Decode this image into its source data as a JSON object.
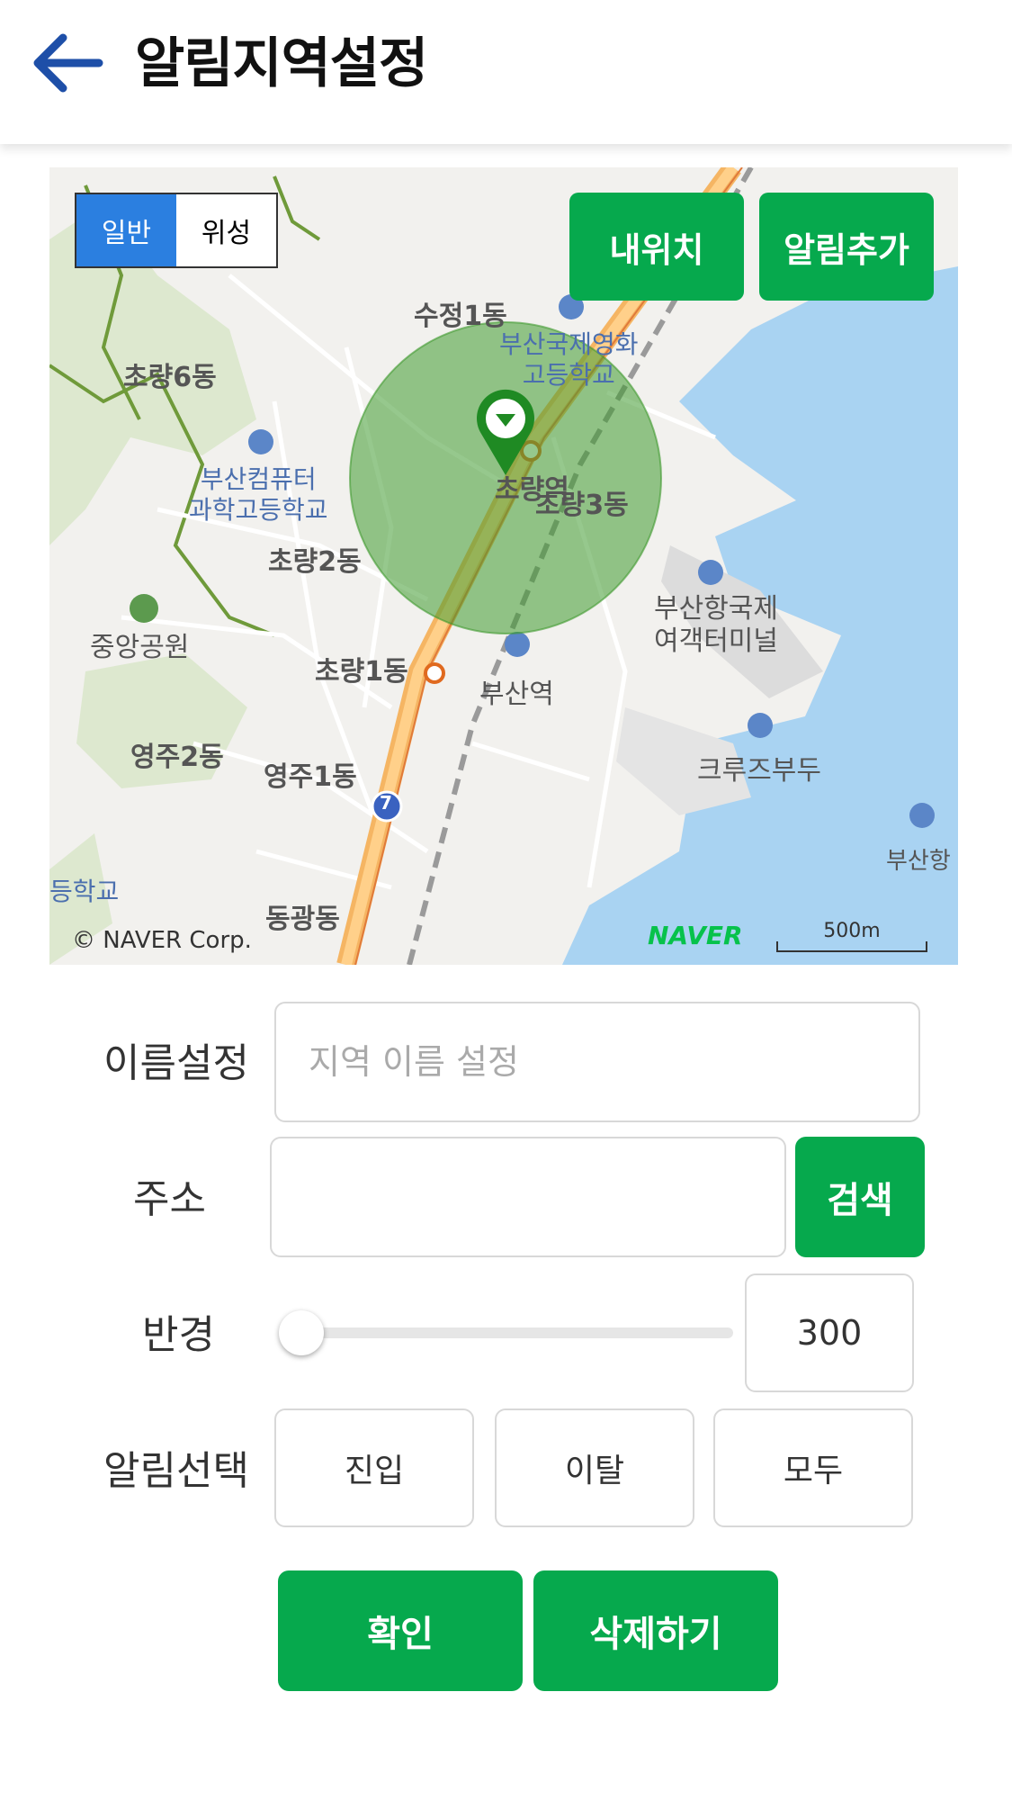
{
  "header": {
    "title": "알림지역설정"
  },
  "map": {
    "type_tabs": [
      {
        "label": "일반",
        "active": true
      },
      {
        "label": "위성",
        "active": false
      }
    ],
    "my_location_label": "내위치",
    "add_alert_label": "알림추가",
    "labels": {
      "sujeong1": "수정1동",
      "busan_film_hs": "부산국제영화\n고등학교",
      "choryang6": "초량6동",
      "busan_computer_hs": "부산컴퓨터\n과학고등학교",
      "choryang_station": "초량역",
      "choryang3": "초량3동",
      "choryang2": "초량2동",
      "junganggongwon": "중앙공원",
      "busan_terminal": "부산항국제\n여객터미널",
      "choryang1": "초량1동",
      "busan_station": "부산역",
      "yeongju2": "영주2동",
      "yeongju1": "영주1동",
      "cruise_pier": "크루즈부두",
      "busan_port": "부산항",
      "donggwang": "동광동",
      "hakgyo": "등학교",
      "route7": "7"
    },
    "copyright": "© NAVER Corp.",
    "logo": "NAVER",
    "scale_label": "500m",
    "colors": {
      "water": "#a9d3f2",
      "park": "#dde8cf",
      "road": "#f5b563",
      "circle": "#3f9a2f"
    }
  },
  "form": {
    "name": {
      "label": "이름설정",
      "placeholder": "지역 이름 설정",
      "value": ""
    },
    "address": {
      "label": "주소",
      "value": "",
      "search_label": "검색"
    },
    "radius": {
      "label": "반경",
      "value": "300",
      "slider_fraction": 0.0
    },
    "alert": {
      "label": "알림선택",
      "options": [
        "진입",
        "이탈",
        "모두"
      ]
    },
    "confirm_label": "확인",
    "delete_label": "삭제하기"
  },
  "accent_color": "#06a94d"
}
